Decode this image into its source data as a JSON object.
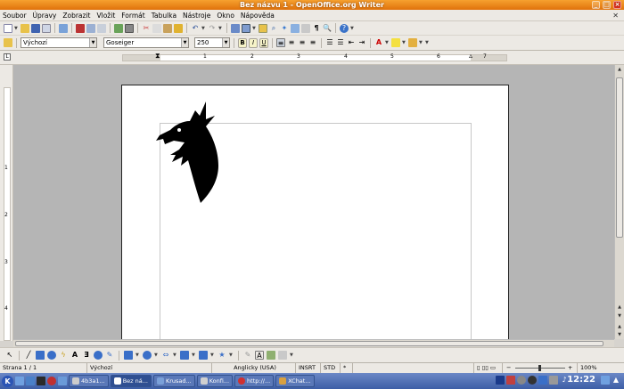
{
  "window": {
    "title": "Bez názvu 1 - OpenOffice.org Writer"
  },
  "menu": [
    "Soubor",
    "Úpravy",
    "Zobrazit",
    "Vložit",
    "Formát",
    "Tabulka",
    "Nástroje",
    "Okno",
    "Nápověda"
  ],
  "format_toolbar": {
    "style": "Výchozí",
    "font": "Goseiger",
    "size": "250",
    "bold": "B",
    "italic": "I",
    "underline": "U"
  },
  "ruler": {
    "marks": [
      "1",
      "2",
      "3",
      "4",
      "5",
      "6",
      "7"
    ]
  },
  "vruler": {
    "marks": [
      "1",
      "2",
      "3",
      "4"
    ]
  },
  "statusbar": {
    "page": "Strana 1 / 1",
    "style": "Výchozí",
    "language": "Anglicky (USA)",
    "insert_mode": "INSRT",
    "selection_mode": "STD",
    "star": "*",
    "zoom": "100%"
  },
  "taskbar": {
    "tasks": [
      "4b3a1...",
      "Bez ná...",
      "Krusad...",
      "Konfi...",
      "http://...",
      "XChat..."
    ],
    "clock": "12:22"
  },
  "colors": {
    "titlebar": "#e58a1f",
    "taskbar": "#4f6fb4",
    "page": "#ffffff",
    "workspace": "#b5b5b5"
  }
}
